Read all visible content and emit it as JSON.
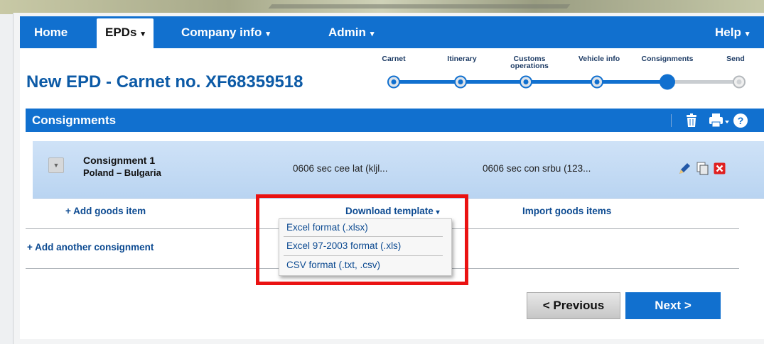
{
  "nav": {
    "home": "Home",
    "epds": "EPDs",
    "company_info": "Company info",
    "admin": "Admin",
    "help": "Help",
    "caret": "▾"
  },
  "page": {
    "title": "New EPD - Carnet no. XF68359518"
  },
  "steps": [
    {
      "label": "Carnet",
      "state": "done"
    },
    {
      "label": "Itinerary",
      "state": "done"
    },
    {
      "label": "Customs operations",
      "state": "done"
    },
    {
      "label": "Vehicle info",
      "state": "done"
    },
    {
      "label": "Consignments",
      "state": "current"
    },
    {
      "label": "Send",
      "state": "pending"
    }
  ],
  "panel": {
    "title": "Consignments",
    "icons": [
      "trash-icon",
      "printer-icon",
      "help-icon"
    ]
  },
  "consignment": {
    "title": "Consignment 1",
    "route": "Poland – Bulgaria",
    "sender": "0606 sec cee lat (kljl...",
    "consignee": "0606 sec con srbu (123...",
    "icons": [
      "edit-pencil-icon",
      "copy-icon",
      "delete-icon"
    ]
  },
  "actions": {
    "add_goods": "+ Add goods item",
    "download_template": "Download template",
    "download_caret": "▾",
    "import_goods": "Import goods items",
    "add_consignment": "+ Add another consignment"
  },
  "download_menu": [
    "Excel format (.xlsx)",
    "Excel 97-2003 format (.xls)",
    "CSV format (.txt, .csv)"
  ],
  "buttons": {
    "previous": "< Previous",
    "next": "Next >"
  },
  "colors": {
    "brand_blue": "#1170cf",
    "title_blue": "#0c5aa6",
    "highlight_red": "#ea1212"
  }
}
